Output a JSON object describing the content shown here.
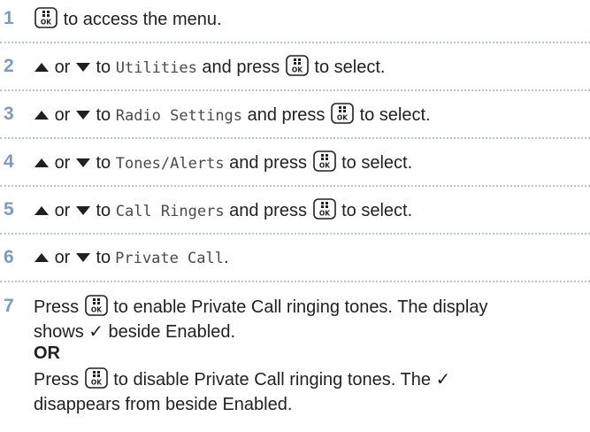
{
  "steps": [
    {
      "num": "1",
      "pre": "",
      "text1": "to access the menu."
    },
    {
      "num": "2",
      "or": "or",
      "to": "to",
      "target": "Utilities",
      "press": "and press",
      "tail": "to select."
    },
    {
      "num": "3",
      "or": "or",
      "to": "to",
      "target": "Radio Settings",
      "press": "and press",
      "tail": "to select."
    },
    {
      "num": "4",
      "or": "or",
      "to": "to",
      "target": "Tones/Alerts",
      "press": "and press",
      "tail": "to select."
    },
    {
      "num": "5",
      "or": "or",
      "to": "to",
      "target": "Call Ringers",
      "press": "and press",
      "tail": "to select."
    },
    {
      "num": "6",
      "or": "or",
      "to": "to",
      "target": "Private Call",
      "period": "."
    },
    {
      "num": "7",
      "press1": "Press",
      "line1_tail": "to enable Private Call ringing tones. The display",
      "line2": "shows ✓ beside Enabled.",
      "or_label": "OR",
      "press2": "Press",
      "line4_tail": "to disable Private Call ringing tones. The ✓",
      "line5": "disappears from beside Enabled."
    }
  ],
  "icons": {
    "menu_ok_key": "menu-ok-key-icon",
    "up": "up-arrow-icon",
    "down": "down-arrow-icon"
  },
  "colors": {
    "step_number": "#7d9bc1",
    "divider": "#b9c3d3",
    "text": "#231f20"
  }
}
